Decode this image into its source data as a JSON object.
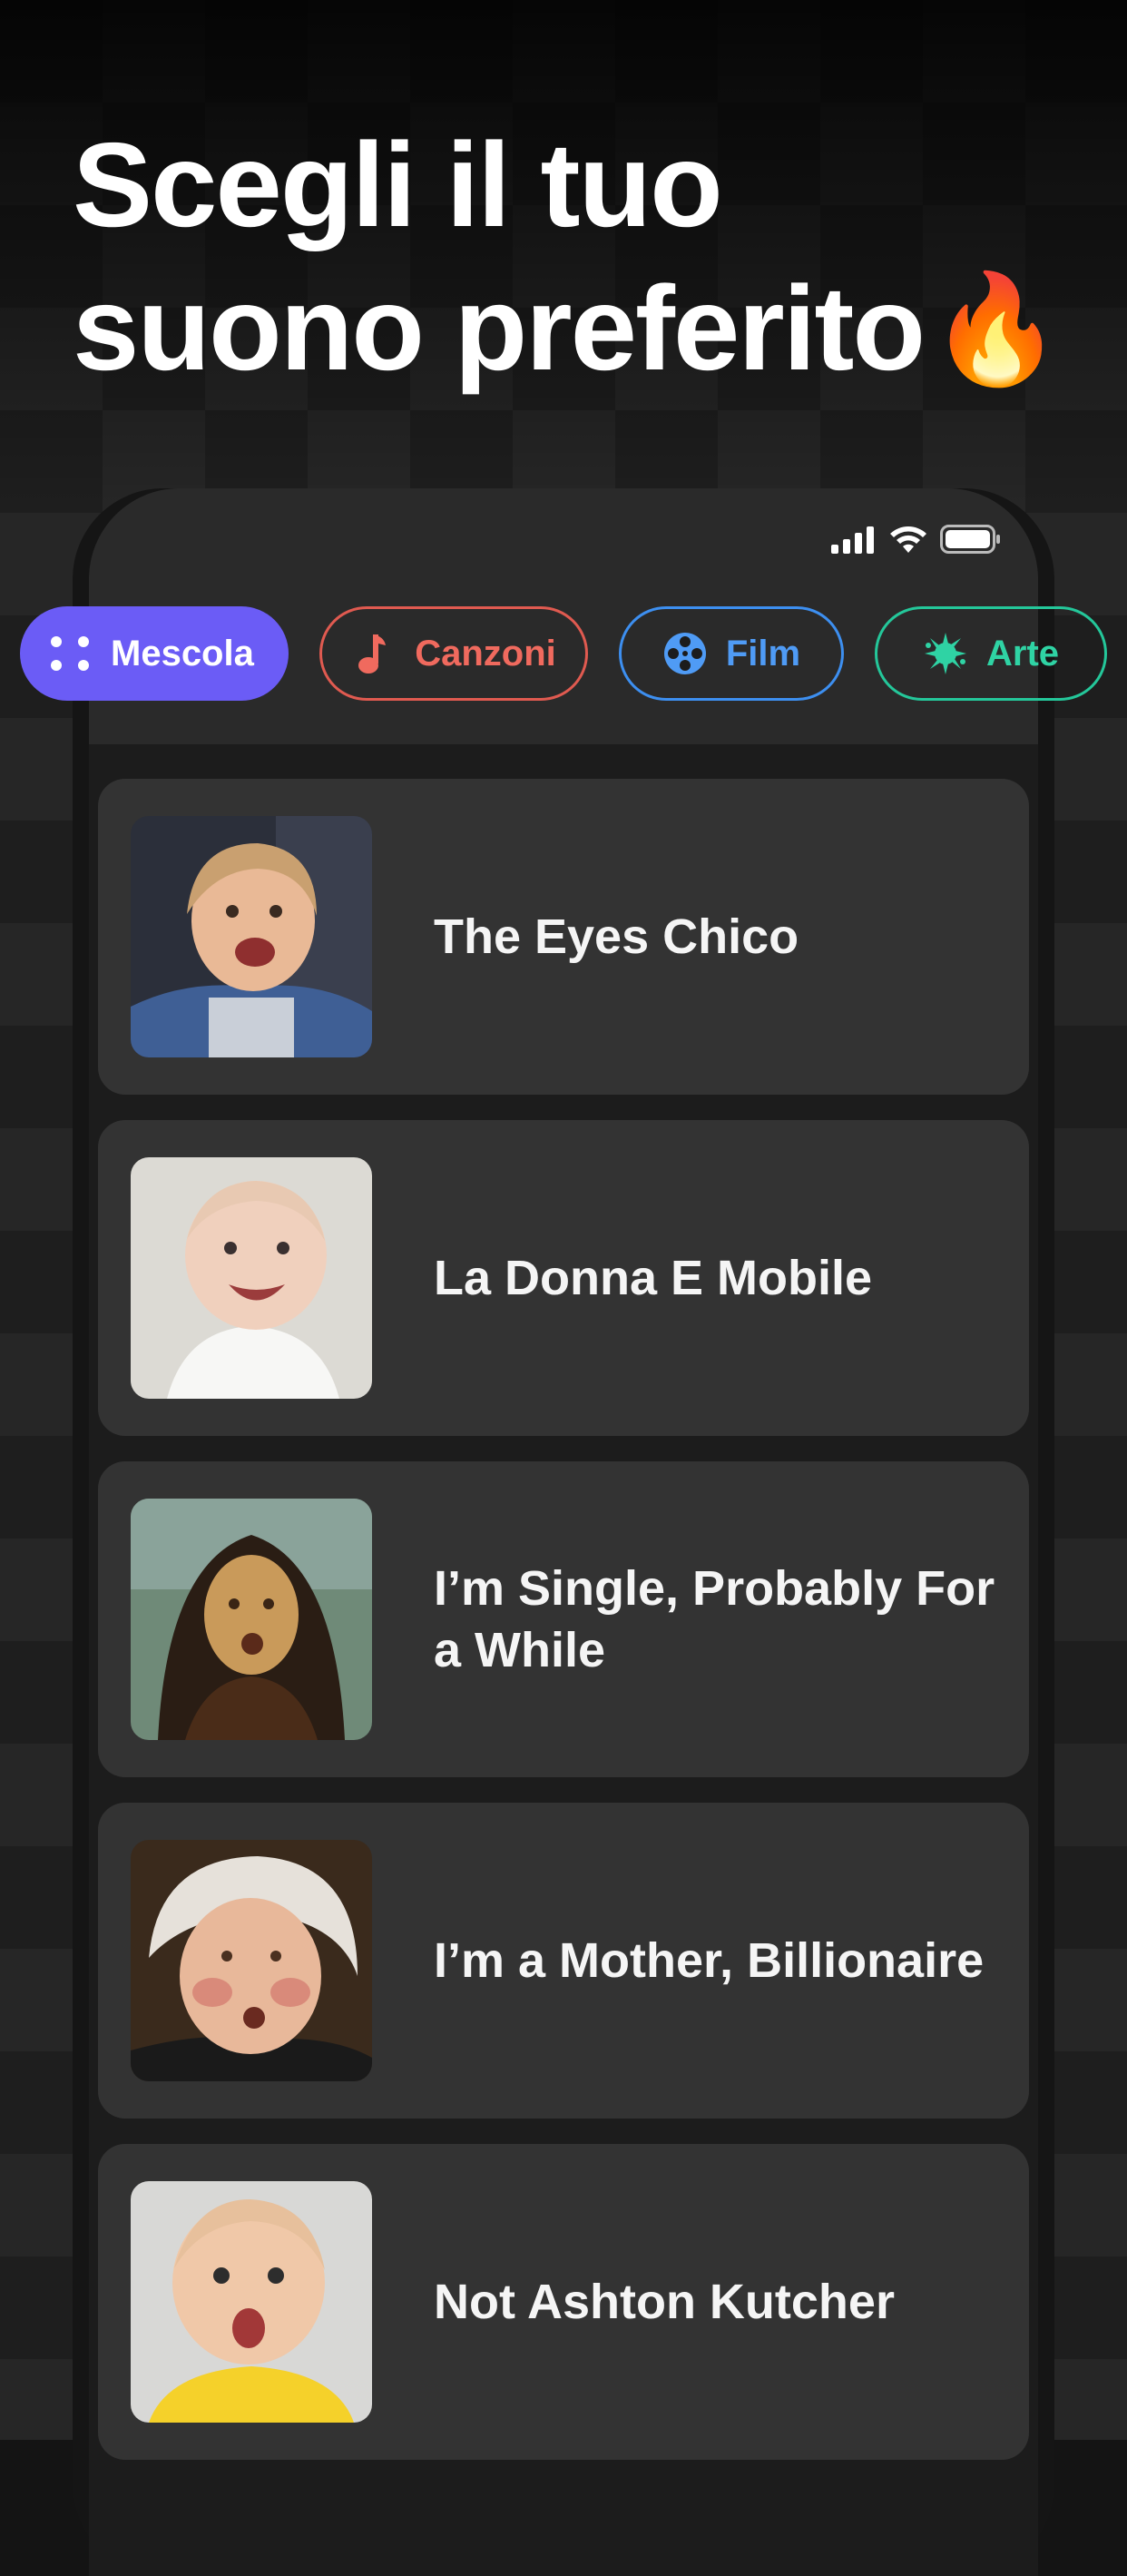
{
  "headline": {
    "line1": "Scegli il tuo",
    "line2": "suono preferito",
    "emoji": "🔥"
  },
  "status_bar": {
    "icons": [
      "cellular-signal-icon",
      "wifi-icon",
      "battery-icon"
    ]
  },
  "categories": [
    {
      "label": "Mescola",
      "icon": "shuffle-dots-icon",
      "color": "#6b5cf6",
      "selected": true
    },
    {
      "label": "Canzoni",
      "icon": "music-note-icon",
      "color": "#f06a5e",
      "selected": false
    },
    {
      "label": "Film",
      "icon": "film-reel-icon",
      "color": "#4f9bf5",
      "selected": false
    },
    {
      "label": "Arte",
      "icon": "paint-splash-icon",
      "color": "#2fd3a4",
      "selected": false
    }
  ],
  "sounds": [
    {
      "title": "The Eyes Chico",
      "thumb": "child-face-thumbnail"
    },
    {
      "title": "La Donna E Mobile",
      "thumb": "baby-face-thumbnail"
    },
    {
      "title": "I’m Single, Probably For a While",
      "thumb": "mona-lisa-thumbnail"
    },
    {
      "title": "I’m a Mother, Billionaire",
      "thumb": "george-washington-thumbnail"
    },
    {
      "title": "Not Ashton Kutcher",
      "thumb": "baby-yellow-shirt-thumbnail"
    }
  ],
  "colors": {
    "background": "#1e1e1e",
    "card": "#333333",
    "accent": "#6b5cf6"
  }
}
